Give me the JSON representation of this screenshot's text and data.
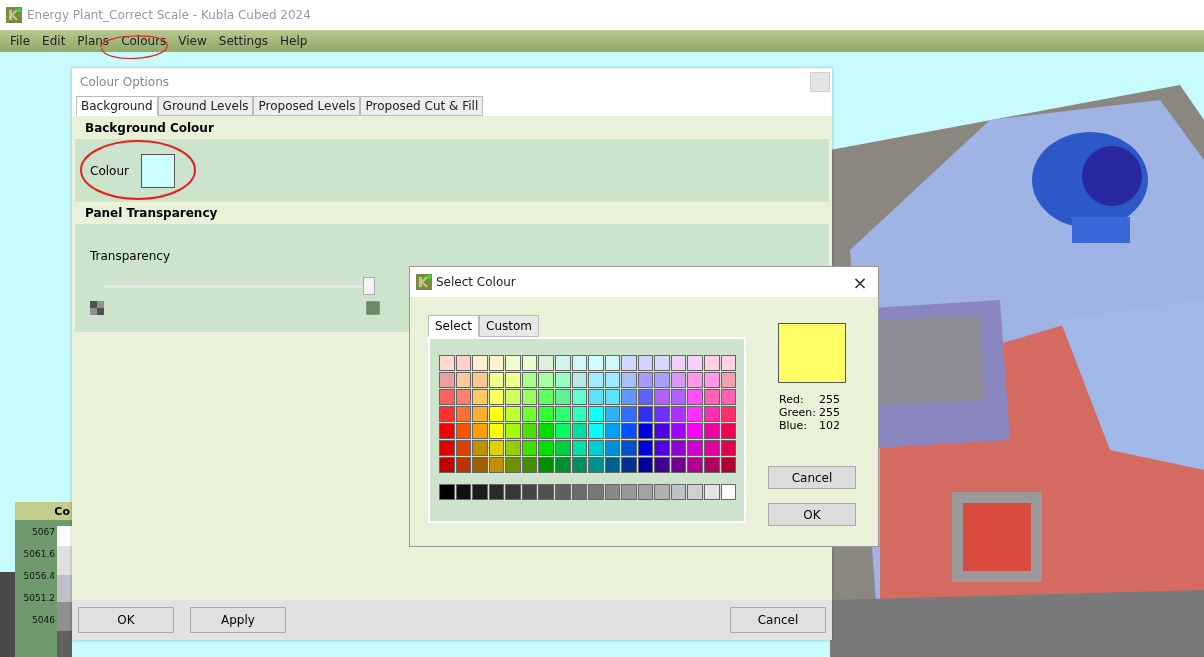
{
  "window": {
    "title": "Energy Plant_Correct Scale - Kubla Cubed 2024"
  },
  "menu": [
    {
      "label": "File"
    },
    {
      "label": "Edit"
    },
    {
      "label": "Plans"
    },
    {
      "label": "Colours"
    },
    {
      "label": "View"
    },
    {
      "label": "Settings"
    },
    {
      "label": "Help"
    }
  ],
  "legend": {
    "title": "Co",
    "ticks": [
      "5067",
      "5061.6",
      "5056.4",
      "5051.2",
      "5046"
    ]
  },
  "colour_options": {
    "title": "Colour Options",
    "tabs": [
      {
        "label": "Background",
        "selected": true
      },
      {
        "label": "Ground Levels",
        "selected": false
      },
      {
        "label": "Proposed Levels",
        "selected": false
      },
      {
        "label": "Proposed Cut & Fill",
        "selected": false
      }
    ],
    "background_section": {
      "heading": "Background Colour",
      "label": "Colour",
      "color": "#ccffff"
    },
    "transparency_section": {
      "heading": "Panel Transparency",
      "label": "Transparency",
      "level": 0.98
    },
    "buttons": [
      {
        "label": "OK"
      },
      {
        "label": "Apply"
      },
      {
        "label": "Cancel"
      }
    ]
  },
  "select_colour": {
    "title": "Select Colour",
    "close": "×",
    "tabs": [
      {
        "label": "Select",
        "selected": true
      },
      {
        "label": "Custom",
        "selected": false
      }
    ],
    "swatch_rows": [
      {
        "swatches": [
          {
            "color": "#ffd8d0"
          },
          {
            "color": "#ffd0c8"
          },
          {
            "color": "#fff0d0"
          },
          {
            "color": "#fff4cc"
          },
          {
            "color": "#f0ffd0"
          },
          {
            "color": "#e8ffd0"
          },
          {
            "color": "#e0f0d8"
          },
          {
            "color": "#d0f4f0"
          },
          {
            "color": "#d0f8f8"
          },
          {
            "color": "#d0ffff"
          },
          {
            "color": "#d0f8f8"
          },
          {
            "color": "#d0d8ff"
          },
          {
            "color": "#d0d4ff"
          },
          {
            "color": "#d8d8ff"
          },
          {
            "color": "#f4d0ff"
          },
          {
            "color": "#f8d0ff"
          },
          {
            "color": "#ffd0e8"
          },
          {
            "color": "#ffd0e8"
          }
        ]
      },
      {
        "swatches": [
          {
            "color": "#e8a0a0"
          },
          {
            "color": "#f8c8a0"
          },
          {
            "color": "#f8c890"
          },
          {
            "color": "#f0ff90"
          },
          {
            "color": "#f0ff90"
          },
          {
            "color": "#a8ff90"
          },
          {
            "color": "#a8ffa0"
          },
          {
            "color": "#98ffc0"
          },
          {
            "color": "#b8e8e8"
          },
          {
            "color": "#a0ecff"
          },
          {
            "color": "#a0e8ff"
          },
          {
            "color": "#a8c0f8"
          },
          {
            "color": "#a898ff"
          },
          {
            "color": "#a8a0ff"
          },
          {
            "color": "#d898f8"
          },
          {
            "color": "#ff98e8"
          },
          {
            "color": "#ff98e8"
          },
          {
            "color": "#f0a0b0"
          }
        ]
      },
      {
        "swatches": [
          {
            "color": "#ff6060"
          },
          {
            "color": "#ff8070"
          },
          {
            "color": "#ffc860"
          },
          {
            "color": "#ffff60"
          },
          {
            "color": "#d0ff60"
          },
          {
            "color": "#98ff60"
          },
          {
            "color": "#60ff60"
          },
          {
            "color": "#60f098"
          },
          {
            "color": "#60ffd0"
          },
          {
            "color": "#60e0ff"
          },
          {
            "color": "#60e0ff"
          },
          {
            "color": "#6098ff"
          },
          {
            "color": "#6060ff"
          },
          {
            "color": "#b060ff"
          },
          {
            "color": "#b060ff"
          },
          {
            "color": "#ff50ff"
          },
          {
            "color": "#ff60b8"
          },
          {
            "color": "#ff60b0"
          }
        ]
      },
      {
        "swatches": [
          {
            "color": "#ff3030"
          },
          {
            "color": "#ff7030"
          },
          {
            "color": "#ffb030"
          },
          {
            "color": "#ffff10"
          },
          {
            "color": "#c0ff30"
          },
          {
            "color": "#70ff30"
          },
          {
            "color": "#30ff30"
          },
          {
            "color": "#30ff70"
          },
          {
            "color": "#30ffc0"
          },
          {
            "color": "#10ffff"
          },
          {
            "color": "#30b0ff"
          },
          {
            "color": "#3070ff"
          },
          {
            "color": "#3030ff"
          },
          {
            "color": "#7030ff"
          },
          {
            "color": "#b030ff"
          },
          {
            "color": "#ff30ff"
          },
          {
            "color": "#ff30b0"
          },
          {
            "color": "#ff3070"
          }
        ]
      },
      {
        "swatches": [
          {
            "color": "#f00000"
          },
          {
            "color": "#ff5000"
          },
          {
            "color": "#ffa000"
          },
          {
            "color": "#ffff00"
          },
          {
            "color": "#a0ff00"
          },
          {
            "color": "#50e000"
          },
          {
            "color": "#00e000"
          },
          {
            "color": "#00ff60"
          },
          {
            "color": "#00e0a0"
          },
          {
            "color": "#00ffff"
          },
          {
            "color": "#00a0ff"
          },
          {
            "color": "#0050ff"
          },
          {
            "color": "#0000e0"
          },
          {
            "color": "#5000e0"
          },
          {
            "color": "#a000ff"
          },
          {
            "color": "#ff00ff"
          },
          {
            "color": "#f000a0"
          },
          {
            "color": "#f00050"
          }
        ]
      },
      {
        "swatches": [
          {
            "color": "#e00000"
          },
          {
            "color": "#e04000"
          },
          {
            "color": "#c09000"
          },
          {
            "color": "#e0d000"
          },
          {
            "color": "#90d000"
          },
          {
            "color": "#40e000"
          },
          {
            "color": "#00e001"
          },
          {
            "color": "#00d040"
          },
          {
            "color": "#00e0a1"
          },
          {
            "color": "#00d0d0"
          },
          {
            "color": "#0090e0"
          },
          {
            "color": "#0050d0"
          },
          {
            "color": "#0000e1"
          },
          {
            "color": "#5000e1"
          },
          {
            "color": "#9000d0"
          },
          {
            "color": "#d000d0"
          },
          {
            "color": "#e000a0"
          },
          {
            "color": "#e00050"
          }
        ]
      },
      {
        "swatches": [
          {
            "color": "#c00000"
          },
          {
            "color": "#c03000"
          },
          {
            "color": "#a06000"
          },
          {
            "color": "#c09001"
          },
          {
            "color": "#709000"
          },
          {
            "color": "#409000"
          },
          {
            "color": "#009000"
          },
          {
            "color": "#009030"
          },
          {
            "color": "#009060"
          },
          {
            "color": "#009090"
          },
          {
            "color": "#006090"
          },
          {
            "color": "#003090"
          },
          {
            "color": "#0000a0"
          },
          {
            "color": "#400090"
          },
          {
            "color": "#700090"
          },
          {
            "color": "#b00090"
          },
          {
            "color": "#b00060"
          },
          {
            "color": "#b00030"
          }
        ]
      }
    ],
    "grey_row": {
      "swatches": [
        {
          "color": "#000000"
        },
        {
          "color": "#101010"
        },
        {
          "color": "#1c1c1c"
        },
        {
          "color": "#2a2a2a"
        },
        {
          "color": "#383838"
        },
        {
          "color": "#444444"
        },
        {
          "color": "#505050"
        },
        {
          "color": "#606060"
        },
        {
          "color": "#6c6c6c"
        },
        {
          "color": "#787878"
        },
        {
          "color": "#888888"
        },
        {
          "color": "#989898"
        },
        {
          "color": "#a4a4a4"
        },
        {
          "color": "#b0b0b0"
        },
        {
          "color": "#c0c0c8"
        },
        {
          "color": "#d0d0d0"
        },
        {
          "color": "#e4e4e4"
        },
        {
          "color": "#ffffff"
        }
      ]
    },
    "preview": {
      "color": "#ffff66"
    },
    "values": [
      {
        "label": "Red:",
        "value": "255"
      },
      {
        "label": "Green:",
        "value": "255"
      },
      {
        "label": "Blue:",
        "value": "102"
      }
    ],
    "buttons": [
      {
        "label": "Cancel"
      },
      {
        "label": "OK"
      }
    ]
  }
}
